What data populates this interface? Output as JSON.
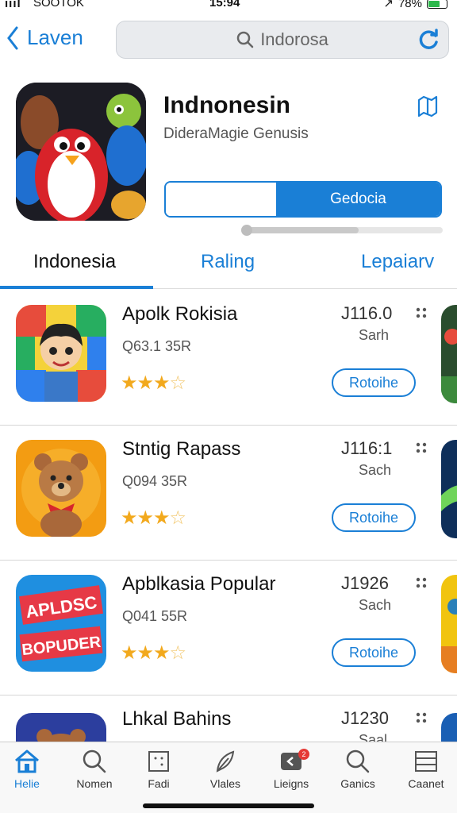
{
  "status_bar": {
    "carrier": "SOOTOK",
    "time": "15:94",
    "battery": "78%"
  },
  "nav": {
    "back_label": "Laven",
    "search_text": "Indorosa"
  },
  "app": {
    "title": "Indnonesin",
    "subtitle": "DideraMagie Genusis",
    "primary_button": "Gedocia",
    "progress_fraction": 0.58
  },
  "tabs": [
    {
      "label": "Indonesia"
    },
    {
      "label": "Raling"
    },
    {
      "label": "Lepaiarv"
    }
  ],
  "list": [
    {
      "name": "Apolk Rokisia",
      "meta": "Q63.1 35R",
      "price": "J116.0",
      "sub": "Sarh",
      "rating": 3.5,
      "button": "Rotoihe"
    },
    {
      "name": "Stntig Rapass",
      "meta": "Q094 35R",
      "price": "J116:1",
      "sub": "Sach",
      "rating": 3.5,
      "button": "Rotoihe"
    },
    {
      "name": "Apblkasia Popular",
      "meta": "Q041 55R",
      "price": "J1926",
      "sub": "Sach",
      "rating": 3.5,
      "button": "Rotoihe"
    },
    {
      "name": "Lhkal Bahins",
      "meta": "",
      "price": "J1230",
      "sub": "Saal",
      "rating": 0,
      "button": ""
    }
  ],
  "promo_icon_text": {
    "top": "APLDSC",
    "bottom": "BOPUDER"
  },
  "tabbar": [
    {
      "label": "Helie",
      "icon": "home-icon",
      "active": true
    },
    {
      "label": "Nomen",
      "icon": "search-icon"
    },
    {
      "label": "Fadi",
      "icon": "grid-icon"
    },
    {
      "label": "Vlales",
      "icon": "feather-icon"
    },
    {
      "label": "Lieigns",
      "icon": "message-icon",
      "badge": "2"
    },
    {
      "label": "Ganics",
      "icon": "search-icon"
    },
    {
      "label": "Caanet",
      "icon": "menu-icon"
    }
  ],
  "colors": {
    "accent": "#1a7fd6",
    "star": "#f2a91d"
  }
}
